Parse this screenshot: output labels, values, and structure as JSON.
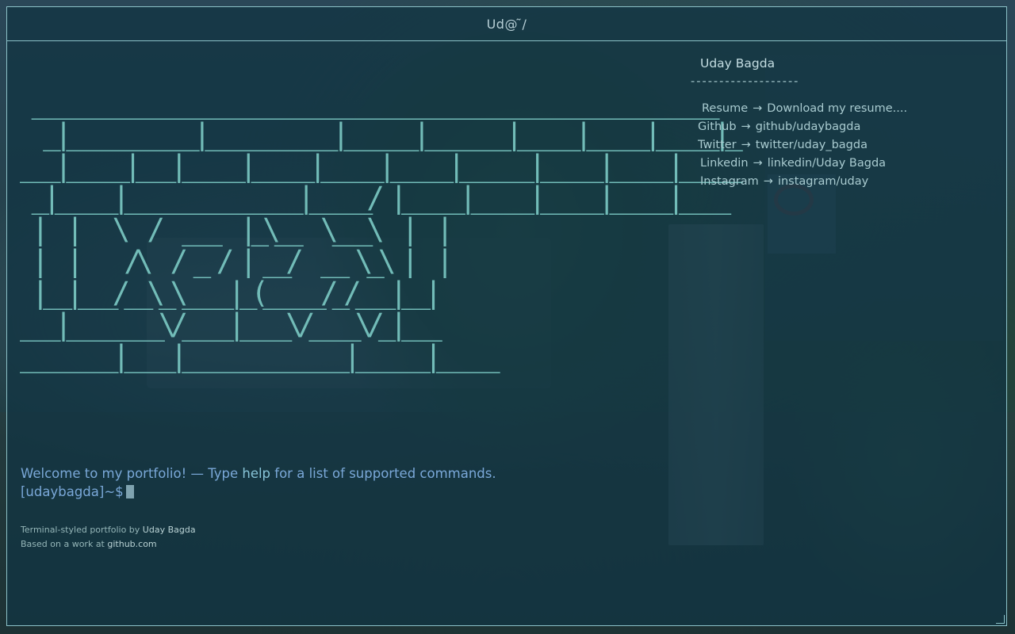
{
  "window": {
    "title": "Ud@ ̃/"
  },
  "banner": {
    "ascii_art": " ___________________________________________________________\n  _|___________|___________|______|_______|_____|_____|_____|_\n___|_____|___|_____|_____|_____|_____|______|_____|_____|_____\n _|_____|_______________|_____/ |_____|_____|_____|_____|____\n |  |   \\  /  ___  |_\\__  \\___\\  |  |\n |  |    /\\  / _ / | __/  __ \\_\\ |  |\n |__|___/__\\_\\____|_(_____/_/___|__|\n___|________\\/____|____\\/____\\/_|___\n________|____|______________|______|_____"
  },
  "sidebar": {
    "name": "Uday Bagda",
    "separator": "-------------------",
    "links": [
      {
        "label": "Resume",
        "value": "Download my resume...."
      },
      {
        "label": "Github",
        "value": "github/udaybagda"
      },
      {
        "label": "Twitter",
        "value": "twitter/uday_bagda"
      },
      {
        "label": "Linkedin",
        "value": "linkedin/Uday Bagda"
      },
      {
        "label": "Instagram",
        "value": "instagram/uday"
      }
    ],
    "arrow": "→"
  },
  "terminal": {
    "welcome_prefix": "Welcome to my portfolio! — Type",
    "welcome_cmd": "help",
    "welcome_suffix": "for a list of supported commands.",
    "prompt": "[udaybagda]~$",
    "input_value": ""
  },
  "footer": {
    "line1_text": "Terminal-styled portfolio by",
    "line1_author": "Uday Bagda",
    "line2_text": "Based on a work at",
    "line2_link": "github.com"
  },
  "colors": {
    "border": "#8cc2c8",
    "ascii": "#72bcb8",
    "welcome": "#7aa8d8"
  }
}
